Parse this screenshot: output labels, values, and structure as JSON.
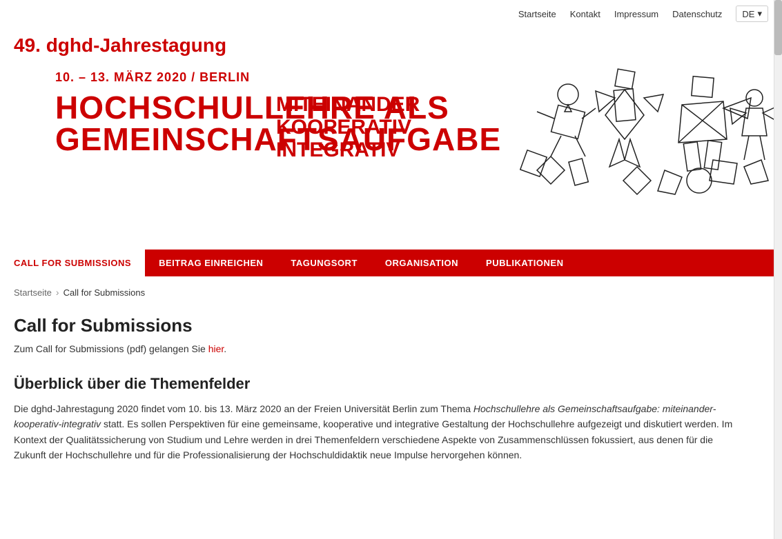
{
  "site": {
    "title": "49. dghd-Jahrestagung"
  },
  "top_nav": {
    "items": [
      {
        "label": "Startseite",
        "href": "#"
      },
      {
        "label": "Kontakt",
        "href": "#"
      },
      {
        "label": "Impressum",
        "href": "#"
      },
      {
        "label": "Datenschutz",
        "href": "#"
      }
    ],
    "lang": "DE"
  },
  "banner": {
    "date": "10. – 13. MÄRZ 2020 / BERLIN",
    "title_line1": "HOCHSCHULLEHRE ALS",
    "title_line2": "GEMEINSCHAFTSAUFGABE",
    "subtitle_line1": "MITEINANDER",
    "subtitle_line2": "KOOPERATIV",
    "subtitle_line3": "INTEGRATIV"
  },
  "main_nav": {
    "items": [
      {
        "label": "CALL FOR SUBMISSIONS",
        "active": true
      },
      {
        "label": "BEITRAG EINREICHEN",
        "active": false
      },
      {
        "label": "TAGUNGSORT",
        "active": false
      },
      {
        "label": "ORGANISATION",
        "active": false
      },
      {
        "label": "PUBLIKATIONEN",
        "active": false
      }
    ]
  },
  "breadcrumb": {
    "home": "Startseite",
    "current": "Call for Submissions"
  },
  "content": {
    "page_title": "Call for Submissions",
    "pdf_text_before": "Zum Call for Submissions (pdf) gelangen Sie ",
    "pdf_link_label": "hier",
    "pdf_text_after": ".",
    "section_title": "Überblick über die Themenfelder",
    "body_text_before": "Die dghd-Jahrestagung 2020 findet vom 10. bis 13. März 2020 an der Freien Universität Berlin zum Thema ",
    "body_text_italic": "Hochschullehre als Gemeinschaftsaufgabe: miteinander-kooperativ-integrativ",
    "body_text_after": " statt. Es sollen Perspektiven für eine gemeinsame, kooperative und integrative Gestaltung der Hochschullehre aufgezeigt und diskutiert werden. Im Kontext der Qualitätssicherung von Studium und Lehre werden in drei Themenfeldern verschiedene Aspekte von Zusammenschlüssen fokussiert, aus denen für die Zukunft der Hochschullehre und für die Professionalisierung der Hochschuldidaktik neue Impulse hervorgehen können."
  },
  "colors": {
    "red": "#cc0000",
    "dark": "#222222",
    "light_gray": "#f0f0f0"
  }
}
